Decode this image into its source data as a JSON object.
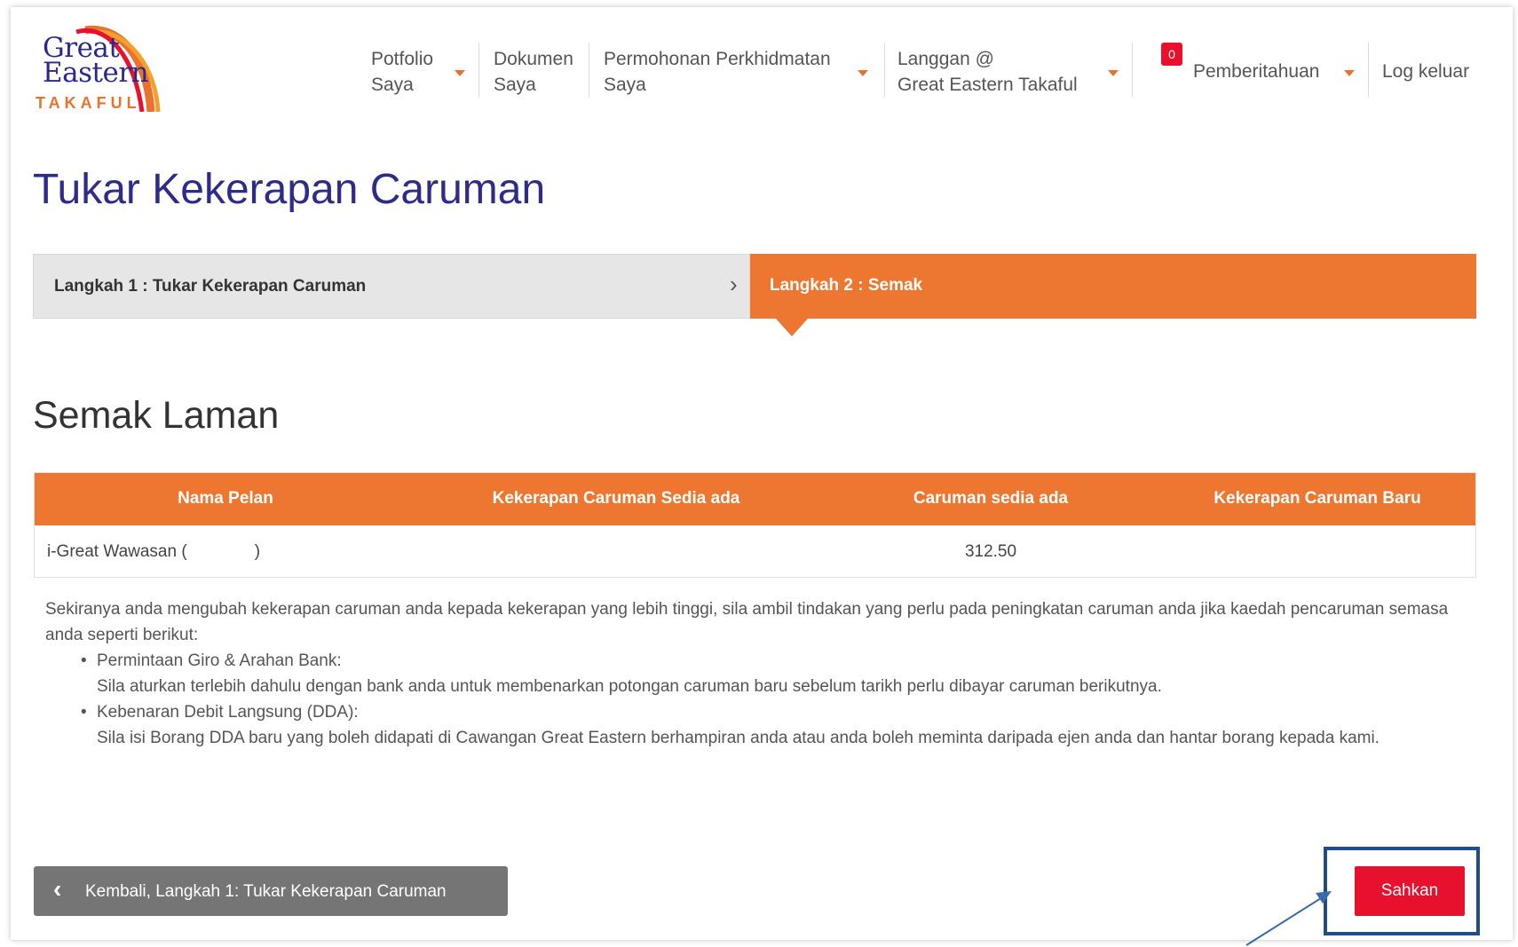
{
  "logo": {
    "line1": "Great",
    "line2": "Eastern",
    "sub": "TAKAFUL"
  },
  "nav": {
    "portfolio_line1": "Potfolio",
    "portfolio_line2": "Saya",
    "documents_line1": "Dokumen",
    "documents_line2": "Saya",
    "service_line1": "Permohonan Perkhidmatan",
    "service_line2": "Saya",
    "subscribe_line1": "Langgan @",
    "subscribe_line2": "Great Eastern Takaful",
    "notification_count": "0",
    "notifications_label": "Pemberitahuan",
    "logout_label": "Log keluar"
  },
  "page": {
    "title": "Tukar Kekerapan Caruman",
    "section_title": "Semak Laman"
  },
  "stepper": {
    "step1_label": "Langkah 1 : Tukar Kekerapan Caruman",
    "step2_label": "Langkah 2 : Semak"
  },
  "table": {
    "headers": [
      "Nama Pelan",
      "Kekerapan Caruman Sedia ada",
      "Caruman sedia ada",
      "Kekerapan Caruman Baru"
    ],
    "rows": [
      {
        "plan_name": "i-Great Wawasan (                    )",
        "current_frequency": "",
        "current_contribution": "312.50",
        "new_frequency": ""
      }
    ]
  },
  "info": {
    "intro": "Sekiranya anda mengubah kekerapan caruman anda kepada kekerapan yang lebih tinggi, sila ambil tindakan yang perlu pada peningkatan caruman anda jika kaedah pencaruman semasa anda seperti berikut:",
    "item1_title": "Permintaan Giro & Arahan Bank:",
    "item1_text": "Sila aturkan terlebih dahulu dengan bank anda untuk membenarkan potongan caruman baru sebelum tarikh perlu dibayar caruman berikutnya.",
    "item2_title": "Kebenaran Debit Langsung (DDA):",
    "item2_text": "Sila isi Borang DDA baru yang boleh didapati di Cawangan Great Eastern berhampiran anda atau anda boleh meminta daripada ejen anda dan hantar borang kepada kami."
  },
  "buttons": {
    "back_label": "Kembali, Langkah 1: Tukar Kekerapan Caruman",
    "confirm_label": "Sahkan"
  },
  "colors": {
    "brand_orange": "#ed7730",
    "brand_navy": "#2d2c8a",
    "confirm_red": "#e8112d",
    "highlight_blue": "#1f4e86"
  }
}
